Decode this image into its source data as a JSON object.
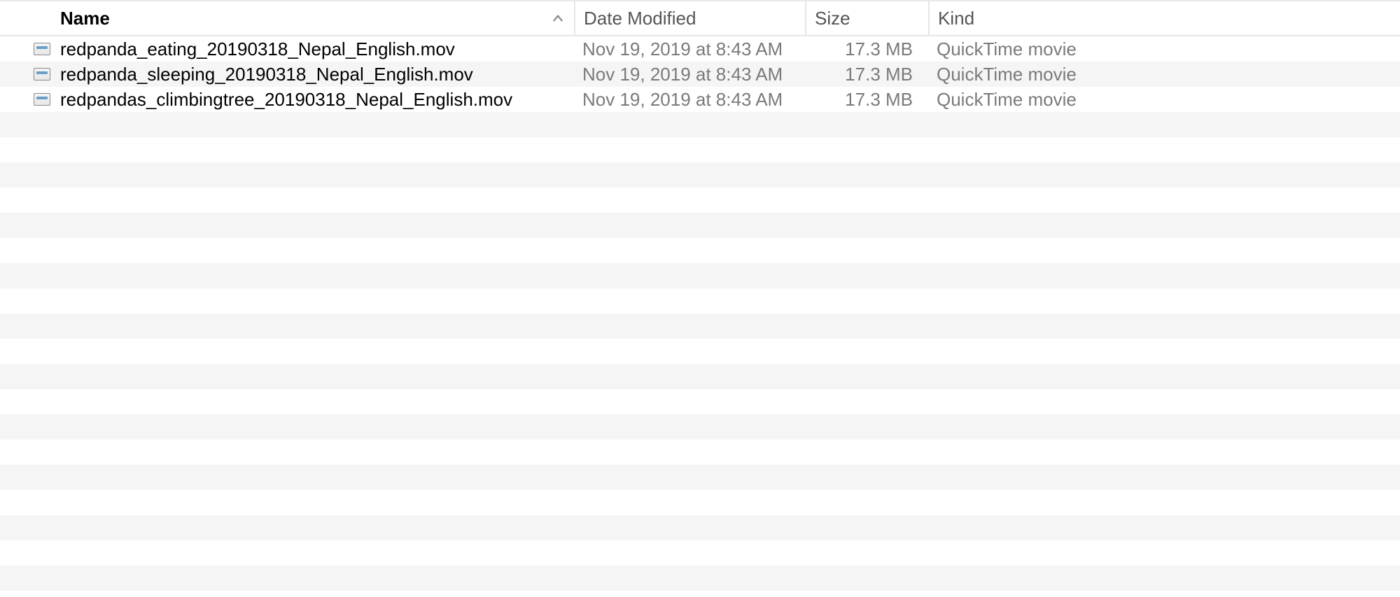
{
  "columns": {
    "name": "Name",
    "date_modified": "Date Modified",
    "size": "Size",
    "kind": "Kind"
  },
  "sort": {
    "column": "name",
    "direction": "ascending"
  },
  "files": [
    {
      "name": "redpanda_eating_20190318_Nepal_English.mov",
      "date_modified": "Nov 19, 2019 at 8:43 AM",
      "size": "17.3 MB",
      "kind": "QuickTime movie"
    },
    {
      "name": "redpanda_sleeping_20190318_Nepal_English.mov",
      "date_modified": "Nov 19, 2019 at 8:43 AM",
      "size": "17.3 MB",
      "kind": "QuickTime movie"
    },
    {
      "name": "redpandas_climbingtree_20190318_Nepal_English.mov",
      "date_modified": "Nov 19, 2019 at 8:43 AM",
      "size": "17.3 MB",
      "kind": "QuickTime movie"
    }
  ]
}
